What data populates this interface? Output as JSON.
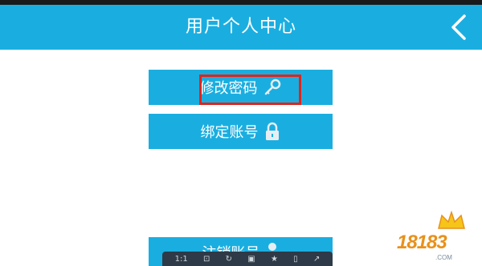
{
  "header": {
    "title": "用户个人中心",
    "accent_color": "#1aaee0"
  },
  "menu": {
    "change_password": {
      "label": "修改密码",
      "icon": "key-icon"
    },
    "bind_account": {
      "label": "绑定账号",
      "icon": "lock-icon"
    },
    "logout": {
      "label": "注销账号",
      "icon": "person-icon"
    }
  },
  "annotation": {
    "color": "#e0241b"
  },
  "toolbar": {
    "ratio_label": "1:1",
    "icons": [
      "crop-icon",
      "rotate-icon",
      "save-icon",
      "star-icon",
      "phone-icon",
      "share-icon"
    ]
  },
  "watermark": {
    "text": "18183",
    "sub": ".COM"
  }
}
